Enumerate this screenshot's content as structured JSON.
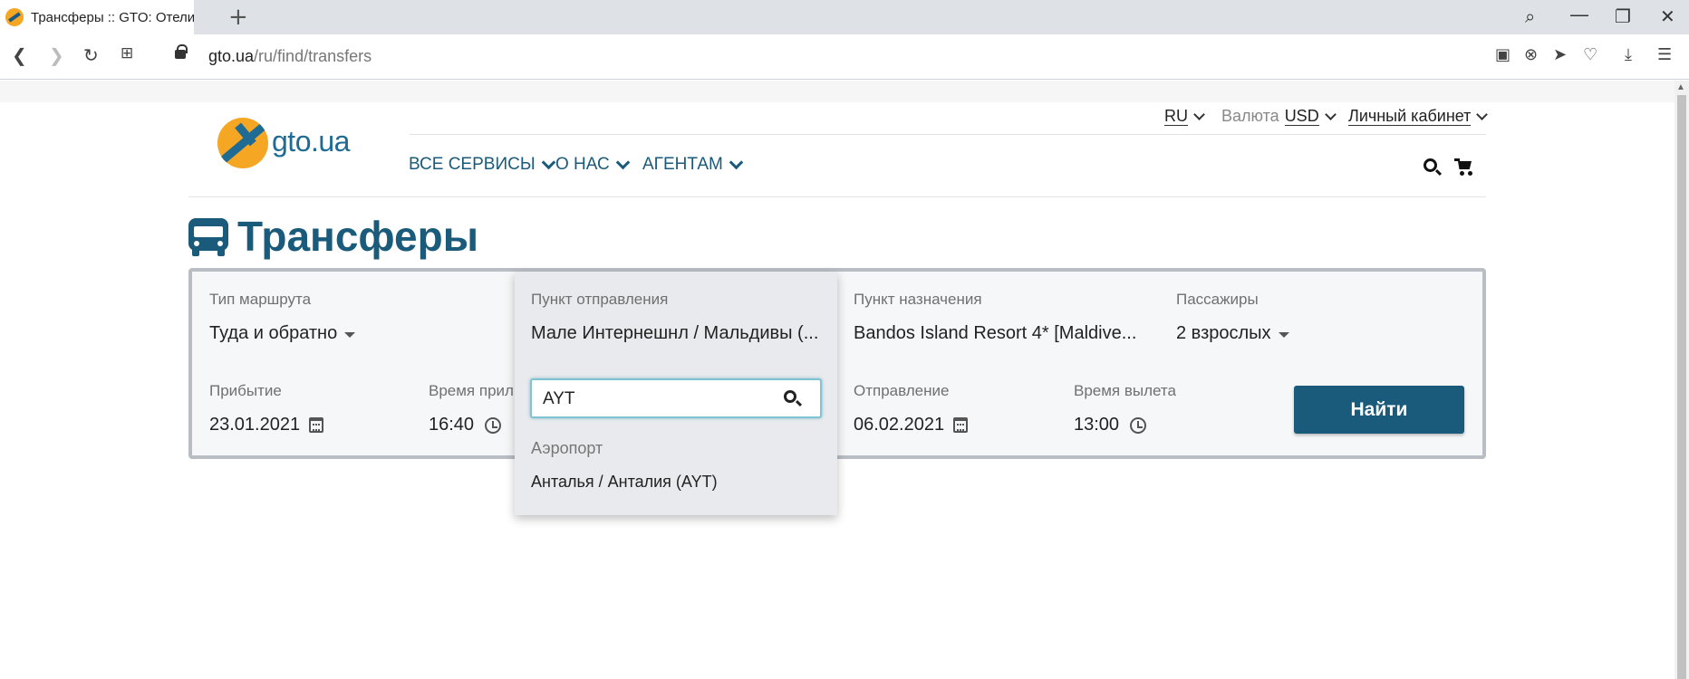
{
  "browser": {
    "tab_title": "Трансферы :: GTO: Отели, Авиа",
    "new_tab": "+",
    "url_host": "gto.ua",
    "url_path": "/ru/find/transfers"
  },
  "header": {
    "logo_text": "gto.ua",
    "language": "RU",
    "currency_label": "Валюта",
    "currency": "USD",
    "account": "Личный кабинет",
    "nav": [
      "ВСЕ СЕРВИСЫ",
      "О НАС",
      "АГЕНТАМ"
    ]
  },
  "page_title": "Трансферы",
  "form": {
    "route_type_label": "Тип маршрута",
    "route_type_value": "Туда и обратно",
    "departure_point_label": "Пункт отправления",
    "departure_point_value": "Мале Интернешнл / Мальдивы (...",
    "destination_label": "Пункт назначения",
    "destination_value": "Bandos Island Resort 4* [Maldive...",
    "passengers_label": "Пассажиры",
    "passengers_value": "2 взрослых",
    "arrival_label": "Прибытие",
    "arrival_value": "23.01.2021",
    "arrival_time_label": "Время прил",
    "arrival_time_value": "16:40",
    "departure_label": "Отправление",
    "departure_value": "06.02.2021",
    "departure_time_label": "Время вылета",
    "departure_time_value": "13:00",
    "submit_label": "Найти"
  },
  "dropdown": {
    "search_value": "AYT",
    "group_label": "Аэропорт",
    "option": "Анталья / Анталия (AYT)"
  },
  "colors": {
    "brand": "#1a5a7a",
    "logo_orange": "#f5a623",
    "focus_border": "#7fc4d3"
  }
}
